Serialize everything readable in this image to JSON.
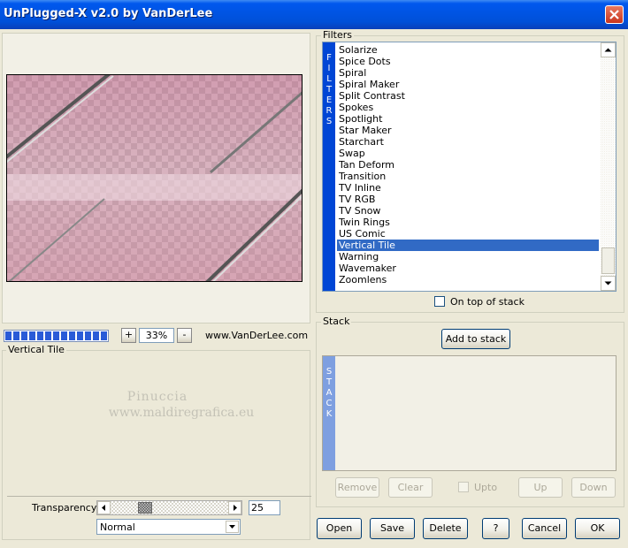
{
  "window": {
    "title": "UnPlugged-X v2.0 by VanDerLee"
  },
  "filters": {
    "group_label": "Filters",
    "side_label": "FILTERS",
    "items": [
      "Solarize",
      "Spice Dots",
      "Spiral",
      "Spiral Maker",
      "Split Contrast",
      "Spokes",
      "Spotlight",
      "Star Maker",
      "Starchart",
      "Swap",
      "Tan Deform",
      "Transition",
      "TV Inline",
      "TV RGB",
      "TV Snow",
      "Twin Rings",
      "US Comic",
      "Vertical Tile",
      "Warning",
      "Wavemaker",
      "Zoomlens"
    ],
    "selected": "Vertical Tile",
    "on_top_label": "On top of stack",
    "on_top_checked": false
  },
  "stack": {
    "group_label": "Stack",
    "side_label": "STACK",
    "add_label": "Add to stack",
    "remove_label": "Remove",
    "clear_label": "Clear",
    "upto_label": "Upto",
    "up_label": "Up",
    "down_label": "Down"
  },
  "zoom": {
    "plus": "+",
    "minus": "-",
    "value": "33%",
    "website": "www.VanDerLee.com"
  },
  "params": {
    "group_label": "Vertical Tile",
    "watermark_line1": "Pinuccia",
    "watermark_line2": "www.maldiregrafica.eu",
    "transparency_label": "Transparency",
    "transparency_value": "25",
    "blend_mode": "Normal"
  },
  "actions": {
    "open": "Open",
    "save": "Save",
    "delete": "Delete",
    "help": "?",
    "cancel": "Cancel",
    "ok": "OK"
  },
  "colors": {
    "titlebar": "#0054e3",
    "selection": "#316ac5",
    "filters_strip": "#0046d5",
    "stack_strip": "#7e9fe0",
    "progress": "#2a5bd7"
  }
}
